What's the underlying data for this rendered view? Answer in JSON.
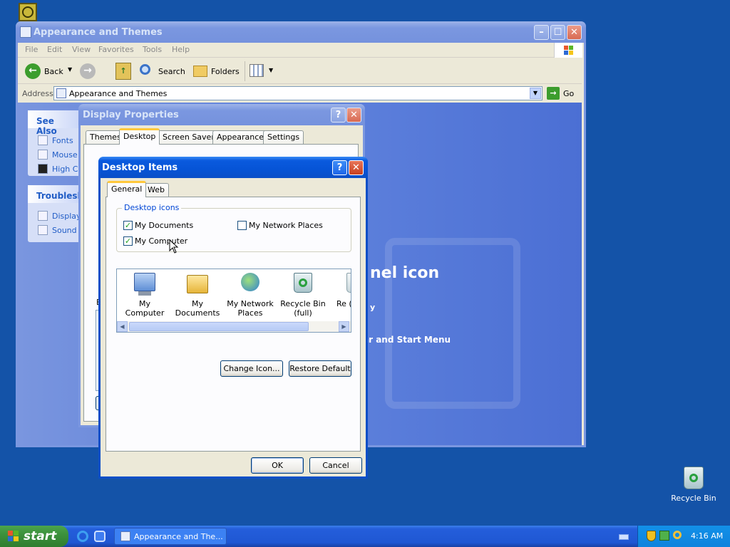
{
  "desktop": {
    "icons": {
      "recycle_bin": "Recycle Bin"
    }
  },
  "explorer": {
    "title": "Appearance and Themes",
    "menu": [
      "File",
      "Edit",
      "View",
      "Favorites",
      "Tools",
      "Help"
    ],
    "toolbar": {
      "back": "Back",
      "search": "Search",
      "folders": "Folders"
    },
    "address_label": "Address",
    "address_value": "Appearance and Themes",
    "go_label": "Go",
    "see_also": {
      "heading": "See Also",
      "links": [
        "Fonts",
        "Mouse I",
        "High Co"
      ]
    },
    "troubleshooters": {
      "heading": "Troublesho",
      "links": [
        "Display",
        "Sound"
      ]
    },
    "background_text": {
      "line1": "nel icon",
      "line2": "y",
      "line3": "ar and Start Menu"
    }
  },
  "display_properties": {
    "title": "Display Properties",
    "tabs": [
      "Themes",
      "Desktop",
      "Screen Saver",
      "Appearance",
      "Settings"
    ],
    "active_tab": "Desktop",
    "partial_label": "B"
  },
  "desktop_items": {
    "title": "Desktop Items",
    "tabs": [
      "General",
      "Web"
    ],
    "active_tab": "General",
    "group_label": "Desktop icons",
    "checkboxes": [
      {
        "label": "My Documents",
        "checked": true
      },
      {
        "label": "My Network Places",
        "checked": false
      },
      {
        "label": "My Computer",
        "checked": true
      }
    ],
    "icons": [
      {
        "label": "My Computer",
        "icon": "my-computer-icon"
      },
      {
        "label": "My Documents",
        "icon": "my-documents-icon"
      },
      {
        "label": "My Network Places",
        "icon": "network-places-icon"
      },
      {
        "label": "Recycle Bin (full)",
        "icon": "recycle-bin-full-icon"
      },
      {
        "label": "Re (",
        "icon": "recycle-bin-empty-icon"
      }
    ],
    "change_icon": "Change Icon...",
    "restore_default": "Restore Default",
    "ok": "OK",
    "cancel": "Cancel"
  },
  "taskbar": {
    "start": "start",
    "task": "Appearance and The...",
    "clock": "4:16 AM"
  },
  "colors": {
    "desktop": "#1453a8",
    "xp_blue": "#0a4fc7",
    "dialog_face": "#ece9d8"
  }
}
